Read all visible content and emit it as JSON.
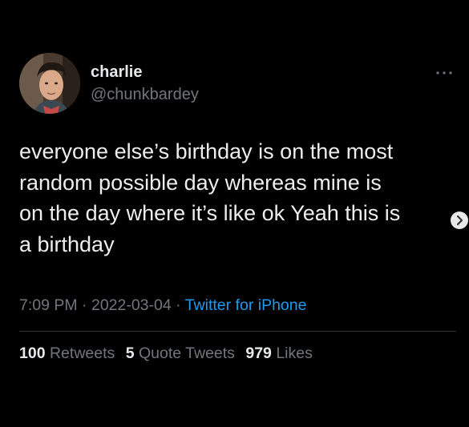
{
  "author": {
    "display_name": "charlie",
    "handle": "@chunkbardey",
    "avatar_icon": "profile-photo"
  },
  "tweet": {
    "text": "everyone else’s birthday is on the most\nrandom possible day whereas mine is\non the day where it’s like ok Yeah this is\na birthday"
  },
  "meta": {
    "time": "7:09 PM",
    "separator": "·",
    "date": "2022-03-04",
    "source": "Twitter for iPhone"
  },
  "stats": {
    "retweets_count": "100",
    "retweets_label": "Retweets",
    "quote_tweets_count": "5",
    "quote_tweets_label": "Quote Tweets",
    "likes_count": "979",
    "likes_label": "Likes"
  },
  "icons": {
    "more": "more-options-icon",
    "next": "next-arrow-icon"
  },
  "colors": {
    "background": "#000000",
    "text": "#e7e9ea",
    "secondary": "#71767b",
    "link": "#1d9bf0",
    "divider": "#2f3336"
  }
}
